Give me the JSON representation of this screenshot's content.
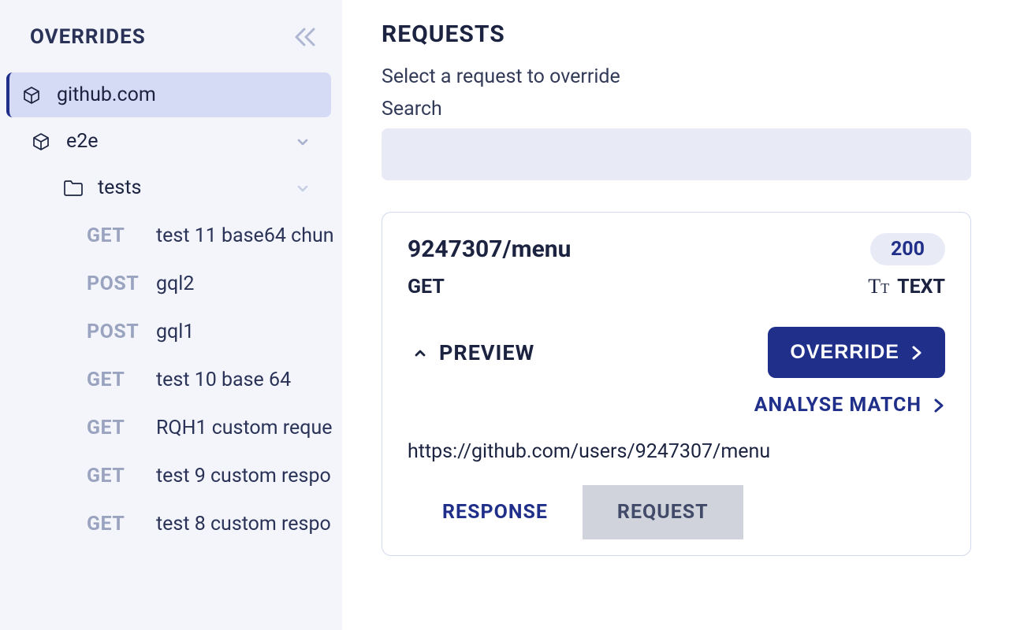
{
  "sidebar": {
    "title": "OVERRIDES",
    "domains": [
      {
        "label": "github.com",
        "selected": true
      },
      {
        "label": "e2e",
        "selected": false
      }
    ],
    "folder": {
      "label": "tests"
    },
    "requests": [
      {
        "method": "GET",
        "label": "test 11 base64 chun"
      },
      {
        "method": "POST",
        "label": "gql2"
      },
      {
        "method": "POST",
        "label": "gql1"
      },
      {
        "method": "GET",
        "label": "test 10 base 64"
      },
      {
        "method": "GET",
        "label": "RQH1 custom reque"
      },
      {
        "method": "GET",
        "label": "test 9 custom respo"
      },
      {
        "method": "GET",
        "label": "test 8 custom respo"
      }
    ]
  },
  "main": {
    "title": "REQUESTS",
    "subtitle": "Select a request to override",
    "search_label": "Search",
    "search_value": "",
    "card": {
      "title": "9247307/menu",
      "status": "200",
      "method": "GET",
      "type": "TEXT",
      "preview_label": "PREVIEW",
      "override_label": "OVERRIDE",
      "analyse_label": "ANALYSE MATCH",
      "url": "https://github.com/users/9247307/menu",
      "tabs": [
        {
          "label": "RESPONSE",
          "active": true
        },
        {
          "label": "REQUEST",
          "active": false
        }
      ]
    }
  }
}
